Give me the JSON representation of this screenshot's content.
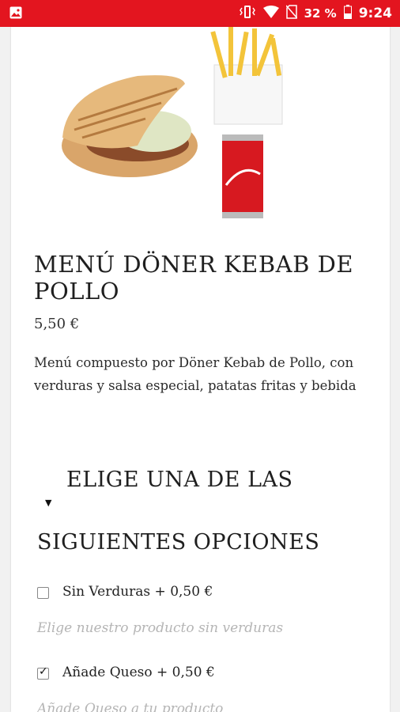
{
  "status_bar": {
    "battery": "32 %",
    "time": "9:24",
    "icons": [
      "image-icon",
      "vibrate-icon",
      "wifi-icon",
      "no-sim-icon",
      "battery-icon"
    ]
  },
  "product": {
    "image_name": "doner-menu-image",
    "title": "MENÚ DÖNER KEBAB DE POLLO",
    "price": "5,50 €",
    "description": "Menú compuesto por Döner Kebab de Pollo, con verduras y salsa especial, patatas fritas y bebida"
  },
  "options": {
    "heading_line1": "ELIGE UNA DE LAS",
    "heading_line2": "SIGUIENTES OPCIONES",
    "items": [
      {
        "label": "Sin Verduras + 0,50 €",
        "note": "Elige nuestro producto sin verduras",
        "checked": false
      },
      {
        "label": "Añade Queso + 0,50 €",
        "note": "Añade Queso a tu producto",
        "checked": true
      }
    ]
  },
  "colors": {
    "accent": "#e3151f",
    "note_text": "#b5b5b5",
    "background": "#f1f1f1"
  }
}
